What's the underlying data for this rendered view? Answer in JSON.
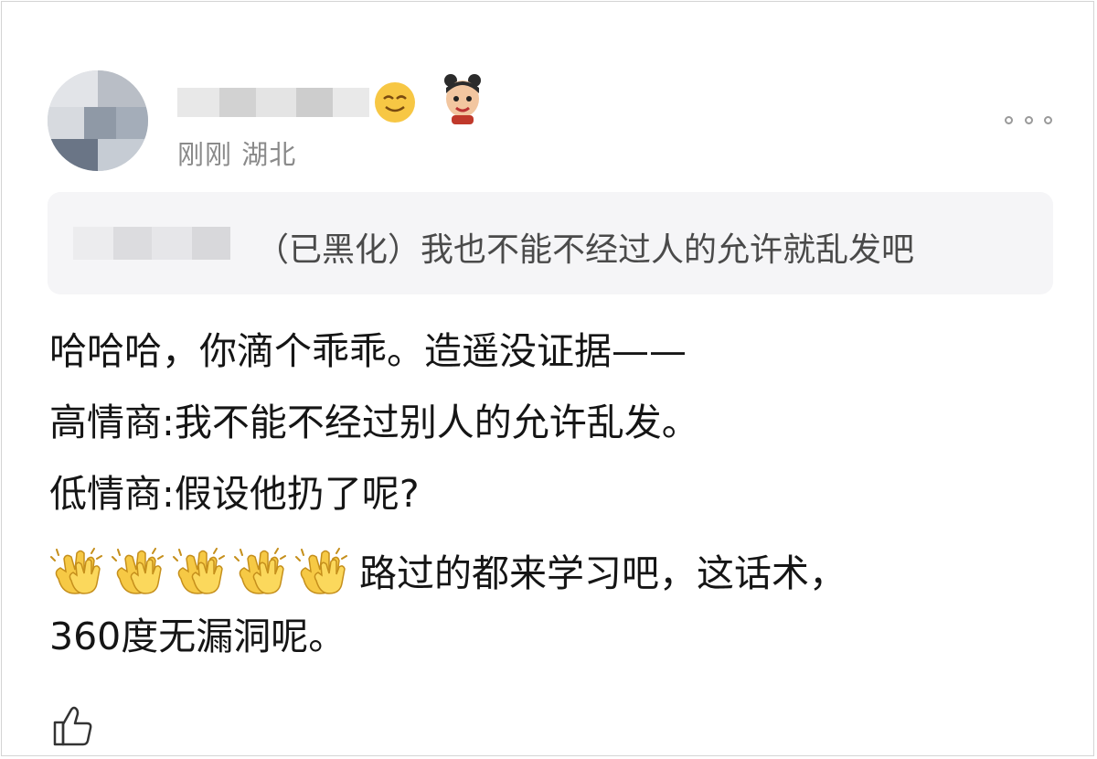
{
  "post": {
    "author": {
      "time": "刚刚",
      "location": "湖北",
      "badges": [
        "smiling-face-icon",
        "cartoon-character-icon"
      ]
    },
    "more_icon": "more-dots-icon",
    "quote": {
      "text": "（已黑化）我也不能不经过人的允许就乱发吧"
    },
    "body": {
      "line1": "哈哈哈，你滴个乖乖。造遥没证据——",
      "line2": "高情商:我不能不经过别人的允许乱发。",
      "line3": "低情商:假设他扔了呢?",
      "clap_icon": "clapping-hands-icon",
      "clap_count": 5,
      "line4": "路过的都来学习吧，这话术，",
      "line5": "360度无漏洞呢。"
    },
    "like_icon": "thumbs-up-icon"
  }
}
